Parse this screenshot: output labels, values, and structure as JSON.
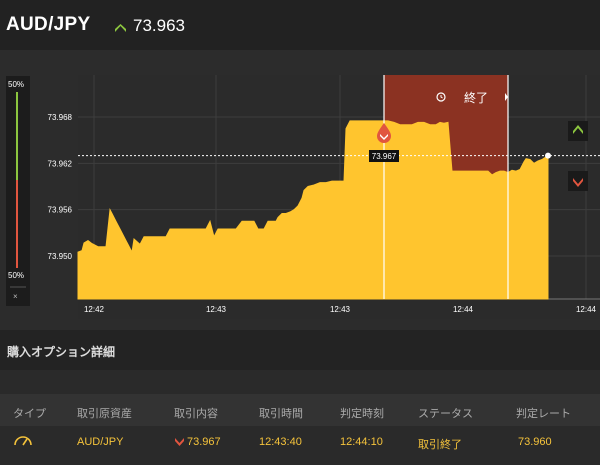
{
  "header": {
    "pair": "AUD/JPY",
    "quote": "73.963",
    "direction_icon": "up-chevron-icon"
  },
  "sidebar": {
    "top_label": "50%",
    "bottom_label": "50%",
    "close_label": "×"
  },
  "chart": {
    "end_label": "終了",
    "tooltip": "73.967",
    "up_button_icon": "up-chevron-icon",
    "down_button_icon": "down-chevron-icon",
    "clock_icon": "history-icon",
    "colors": {
      "area": "#ffc52e",
      "expired": "#8b3222",
      "up": "#8cc63f",
      "down": "#e1553f",
      "line": "#ffffff"
    }
  },
  "chart_data": {
    "type": "area",
    "y_ticks": [
      "73.968",
      "73.962",
      "73.956",
      "73.950"
    ],
    "y_tick_values": [
      73.968,
      73.962,
      73.956,
      73.95
    ],
    "x_tick_labels": [
      "12:42",
      "12:43",
      "12:43",
      "12:44",
      "12:44"
    ],
    "current_rate": 73.963,
    "entry_rate": 73.967,
    "grid": true,
    "series": [
      {
        "values": [
          [
            0,
            73.9505
          ],
          [
            4,
            73.9507
          ],
          [
            6,
            73.9517
          ],
          [
            10,
            73.952
          ],
          [
            14,
            73.9516
          ],
          [
            20,
            73.9512
          ],
          [
            24,
            73.9512
          ],
          [
            28,
            73.9512
          ],
          [
            32,
            73.956
          ],
          [
            34,
            73.9555
          ],
          [
            38,
            73.9545
          ],
          [
            42,
            73.9535
          ],
          [
            46,
            73.9525
          ],
          [
            50,
            73.9515
          ],
          [
            54,
            73.9505
          ],
          [
            56,
            73.9522
          ],
          [
            62,
            73.9515
          ],
          [
            66,
            73.9525
          ],
          [
            70,
            73.9525
          ],
          [
            74,
            73.9525
          ],
          [
            80,
            73.9525
          ],
          [
            84,
            73.9525
          ],
          [
            88,
            73.9525
          ],
          [
            92,
            73.9535
          ],
          [
            98,
            73.9535
          ],
          [
            104,
            73.9535
          ],
          [
            110,
            73.9535
          ],
          [
            116,
            73.9535
          ],
          [
            120,
            73.9535
          ],
          [
            124,
            73.9535
          ],
          [
            128,
            73.9535
          ],
          [
            132,
            73.9545
          ],
          [
            136,
            73.9525
          ],
          [
            140,
            73.9535
          ],
          [
            146,
            73.9535
          ],
          [
            152,
            73.9535
          ],
          [
            158,
            73.9535
          ],
          [
            164,
            73.9545
          ],
          [
            168,
            73.9545
          ],
          [
            172,
            73.9545
          ],
          [
            176,
            73.9545
          ],
          [
            180,
            73.9535
          ],
          [
            186,
            73.9535
          ],
          [
            190,
            73.9545
          ],
          [
            194,
            73.9545
          ],
          [
            198,
            73.9545
          ],
          [
            200,
            73.955
          ],
          [
            204,
            73.9555
          ],
          [
            208,
            73.9555
          ],
          [
            212,
            73.9557
          ],
          [
            216,
            73.956
          ],
          [
            220,
            73.9565
          ],
          [
            224,
            73.9575
          ],
          [
            226,
            73.9585
          ],
          [
            230,
            73.959
          ],
          [
            236,
            73.9592
          ],
          [
            242,
            73.9595
          ],
          [
            248,
            73.9595
          ],
          [
            254,
            73.9597
          ],
          [
            258,
            73.9597
          ],
          [
            262,
            73.9597
          ],
          [
            266,
            73.9597
          ],
          [
            268,
            73.9665
          ],
          [
            272,
            73.9675
          ],
          [
            276,
            73.9675
          ],
          [
            280,
            73.9675
          ],
          [
            286,
            73.9675
          ],
          [
            292,
            73.9675
          ],
          [
            298,
            73.9675
          ],
          [
            300,
            73.9675
          ],
          [
            306,
            73.9675
          ],
          [
            310,
            73.9675
          ],
          [
            316,
            73.9673
          ],
          [
            322,
            73.967
          ],
          [
            328,
            73.967
          ],
          [
            334,
            73.967
          ],
          [
            340,
            73.9673
          ],
          [
            346,
            73.9673
          ],
          [
            352,
            73.967
          ],
          [
            358,
            73.967
          ],
          [
            362,
            73.9673
          ],
          [
            366,
            73.9672
          ],
          [
            370,
            73.9673
          ],
          [
            374,
            73.961
          ],
          [
            380,
            73.961
          ],
          [
            386,
            73.961
          ],
          [
            392,
            73.961
          ],
          [
            398,
            73.961
          ],
          [
            404,
            73.961
          ],
          [
            410,
            73.961
          ],
          [
            414,
            73.9605
          ],
          [
            418,
            73.9608
          ],
          [
            422,
            73.961
          ],
          [
            426,
            73.961
          ],
          [
            430,
            73.9608
          ],
          [
            434,
            73.9611
          ],
          [
            438,
            73.961
          ],
          [
            442,
            73.9612
          ],
          [
            446,
            73.9622
          ],
          [
            448,
            73.9626
          ],
          [
            452,
            73.9625
          ],
          [
            456,
            73.962
          ],
          [
            460,
            73.9623
          ],
          [
            464,
            73.9625
          ],
          [
            470,
            73.963
          ]
        ]
      }
    ]
  },
  "details": {
    "title": "購入オプション詳細",
    "columns": [
      "タイプ",
      "取引原資産",
      "取引内容",
      "取引時間",
      "判定時刻",
      "ステータス",
      "判定レート"
    ],
    "row": {
      "type_icon": "gauge-icon",
      "asset": "AUD/JPY",
      "trade_icon": "down-chevron-icon",
      "trade_rate": "73.967",
      "trade_time": "12:43:40",
      "judge_time": "12:44:10",
      "status": "取引終了",
      "judge_rate": "73.960"
    }
  }
}
